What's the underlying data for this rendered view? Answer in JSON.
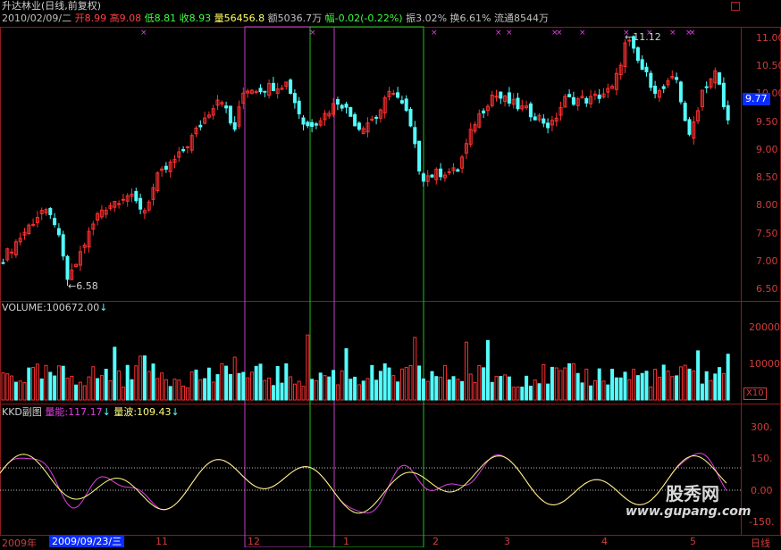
{
  "header": {
    "stock_name": "升达林业(日线,前复权)",
    "date": "2010/02/09/二",
    "open_label": "开",
    "open_value": "8.99",
    "high_label": "高",
    "high_value": "9.08",
    "low_label": "低",
    "low_value": "8.81",
    "close_label": "收",
    "close_value": "8.93",
    "volume_label": "量",
    "volume_value": "56456.8",
    "amount_label": "额",
    "amount_value": "5036.7万",
    "change_label": "幅",
    "change_value": "-0.02(-0.22%)",
    "amplitude_label": "振",
    "amplitude_value": "3.02%",
    "turnover_label": "换",
    "turnover_value": "6.61%",
    "float_label": "流通",
    "float_value": "8544万"
  },
  "price_axis": [
    "11.00",
    "10.50",
    "10.00",
    "9.50",
    "9.00",
    "8.50",
    "8.00",
    "7.50",
    "7.00",
    "6.50"
  ],
  "current_price_tag": "9.77",
  "low_marker": "6.58",
  "high_marker": "11.12",
  "volume_panel": {
    "label": "VOLUME:100672.00",
    "arrow": "↓",
    "axis": [
      "20000",
      "10000"
    ],
    "scale_badge": "X10"
  },
  "kkd_panel": {
    "name": "KKD副图",
    "line1_label": "量能:117.17",
    "line1_arrow": "↓",
    "line2_label": "量波:109.43",
    "line2_arrow": "↓",
    "axis": [
      "300.",
      "150.",
      "0.00",
      "-150."
    ]
  },
  "x_axis": {
    "year_label": "2009年",
    "cursor_date": "2009/09/23/三",
    "ticks": [
      "11",
      "12",
      "1",
      "2",
      "3",
      "4",
      "5"
    ],
    "period_label": "日线"
  },
  "watermark": {
    "cn": "股秀网",
    "url": "www.gupang.com"
  },
  "colors": {
    "up": "#ff3030",
    "down": "#54fcfc",
    "grid": "#8a1c1c",
    "magenta": "#e040e0",
    "yellow": "#ffff80",
    "green_box": "#20c020",
    "magenta_box": "#c040c0"
  }
}
